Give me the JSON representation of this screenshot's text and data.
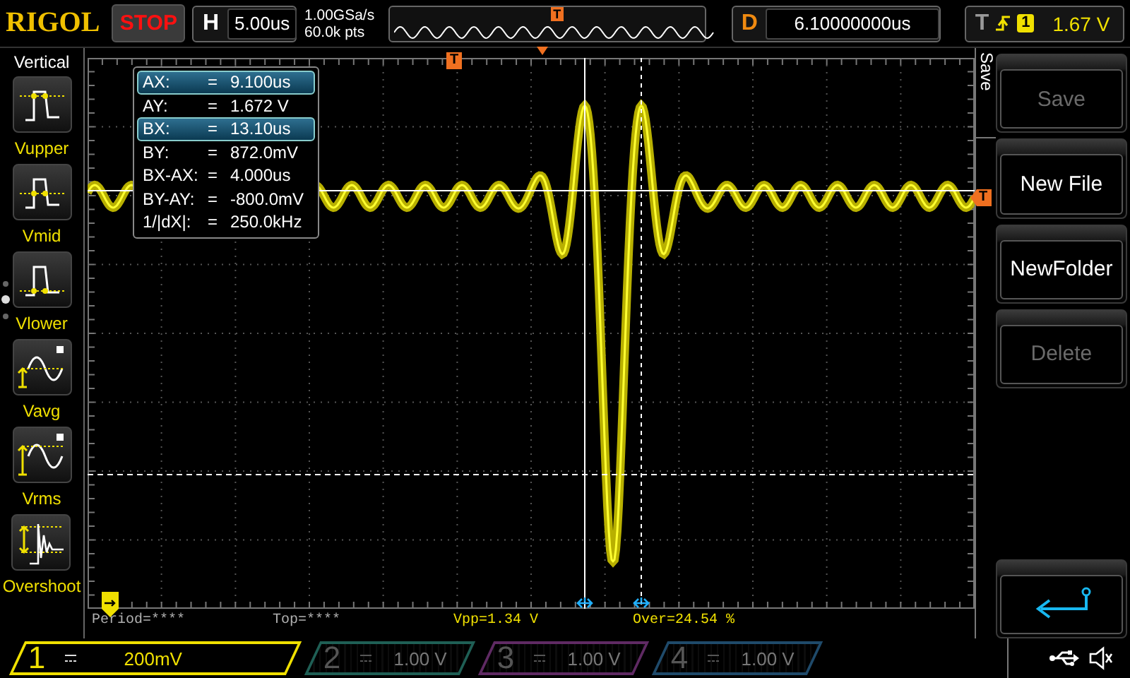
{
  "top_bar": {
    "logo": "RIGOL",
    "run_state": "STOP",
    "horizontal": {
      "label": "H",
      "value": "5.00us"
    },
    "sample_rate": "1.00GSa/s",
    "memory_depth": "60.0k pts",
    "memory_marker": "T",
    "delay": {
      "label": "D",
      "value": "6.10000000us"
    },
    "trigger": {
      "label": "T",
      "source": "1",
      "level": "1.67 V"
    }
  },
  "sidebar": {
    "title": "Vertical",
    "items": [
      {
        "label": "Vupper",
        "kind": "upper"
      },
      {
        "label": "Vmid",
        "kind": "mid"
      },
      {
        "label": "Vlower",
        "kind": "lower"
      },
      {
        "label": "Vavg",
        "kind": "avg"
      },
      {
        "label": "Vrms",
        "kind": "rms"
      },
      {
        "label": "Overshoot",
        "kind": "overshoot"
      }
    ]
  },
  "display": {
    "trigger_marker": "T",
    "level_marker": "T",
    "cursor_readout": [
      {
        "name": "AX:",
        "equals": "=",
        "value": "9.100us",
        "selected": true
      },
      {
        "name": "AY:",
        "equals": "=",
        "value": "1.672 V",
        "selected": false
      },
      {
        "name": "BX:",
        "equals": "=",
        "value": "13.10us",
        "selected": true
      },
      {
        "name": "BY:",
        "equals": "=",
        "value": "872.0mV",
        "selected": false
      },
      {
        "name": "BX-AX:",
        "equals": "=",
        "value": "4.000us",
        "selected": false
      },
      {
        "name": "BY-AY:",
        "equals": "=",
        "value": "-800.0mV",
        "selected": false
      },
      {
        "name": "1/|dX|:",
        "equals": "=",
        "value": "250.0kHz",
        "selected": false
      }
    ]
  },
  "measurements": [
    {
      "text": "Period=****",
      "color": "#b0b0b0"
    },
    {
      "text": "Top=****",
      "color": "#b0b0b0"
    },
    {
      "text": "Vpp=1.34 V",
      "color": "#f0e000"
    },
    {
      "text": "Over=24.54 %",
      "color": "#f0e000"
    }
  ],
  "menu": {
    "title": "Save",
    "buttons": [
      {
        "kind": "text",
        "label": "Save",
        "disabled": true
      },
      {
        "kind": "text",
        "label": "New File",
        "disabled": false
      },
      {
        "kind": "text",
        "label": "NewFolder",
        "disabled": false
      },
      {
        "kind": "text",
        "label": "Delete",
        "disabled": true
      },
      {
        "kind": "back",
        "disabled": false
      }
    ]
  },
  "channels": [
    {
      "number": "1",
      "scale": "200mV",
      "on": true,
      "color": "#f0e000"
    },
    {
      "number": "2",
      "scale": "1.00 V",
      "on": false,
      "color": "#1f5f55"
    },
    {
      "number": "3",
      "scale": "1.00 V",
      "on": false,
      "color": "#5f2a63"
    },
    {
      "number": "4",
      "scale": "1.00 V",
      "on": false,
      "color": "#1f4a6a"
    }
  ]
}
